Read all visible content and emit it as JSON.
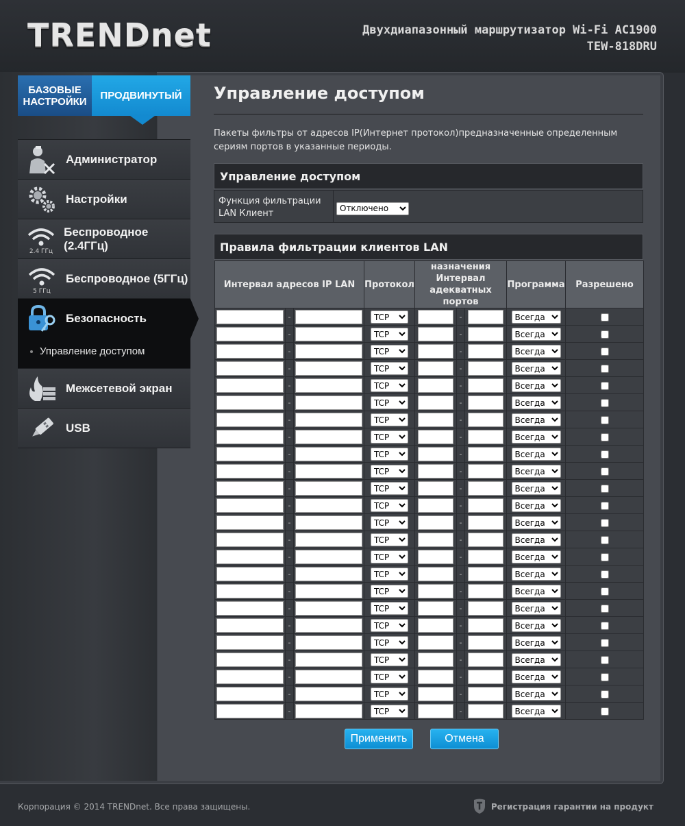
{
  "header": {
    "logo": "TRENDnet",
    "product_line1": "Двухдиапазонный маршрутизатор Wi-Fi AC1900",
    "product_line2": "TEW-818DRU"
  },
  "tabs": {
    "basic_line1": "БАЗОВЫЕ",
    "basic_line2": "НАСТРОЙКИ",
    "advanced": "ПРОДВИНУТЫЙ"
  },
  "sidebar": {
    "items": [
      {
        "label": "Администратор",
        "icon": "administrator-icon"
      },
      {
        "label": "Настройки",
        "icon": "gears-icon"
      },
      {
        "label": "Беспроводное (2.4ГГц)",
        "icon": "wifi-2-4ghz-icon",
        "icon_caption": "2.4 ГГц"
      },
      {
        "label": "Беспроводное (5ГГц)",
        "icon": "wifi-5ghz-icon",
        "icon_caption": "5 ГГц"
      },
      {
        "label": "Безопасность",
        "icon": "lock-key-icon"
      },
      {
        "label": "Межсетевой экран",
        "icon": "firewall-icon"
      },
      {
        "label": "USB",
        "icon": "usb-icon"
      }
    ],
    "sub_item": "Управление доступом"
  },
  "main": {
    "title": "Управление доступом",
    "description": "Пакеты фильтры от адресов IP(Интернет протокол)предназначенные определенным сериям портов в указанные периоды.",
    "access_section": {
      "title": "Управление доступом",
      "filter_label": "Функция фильтрации LAN Клиент",
      "filter_value": "Отключено"
    },
    "rules_section": {
      "title": "Правила фильтрации клиентов LAN",
      "columns": {
        "ip_range": "Интервал адресов IP LAN",
        "protocol": "Протокол",
        "port_range": "назначения Интервал адекватных портов",
        "schedule": "Программа",
        "allowed": "Разрешено"
      },
      "separator": "-",
      "rows": [
        {
          "ip_start": "",
          "ip_end": "",
          "protocol": "TCP",
          "port_start": "",
          "port_end": "",
          "schedule": "Всегда",
          "allowed": false
        },
        {
          "ip_start": "",
          "ip_end": "",
          "protocol": "TCP",
          "port_start": "",
          "port_end": "",
          "schedule": "Всегда",
          "allowed": false
        },
        {
          "ip_start": "",
          "ip_end": "",
          "protocol": "TCP",
          "port_start": "",
          "port_end": "",
          "schedule": "Всегда",
          "allowed": false
        },
        {
          "ip_start": "",
          "ip_end": "",
          "protocol": "TCP",
          "port_start": "",
          "port_end": "",
          "schedule": "Всегда",
          "allowed": false
        },
        {
          "ip_start": "",
          "ip_end": "",
          "protocol": "TCP",
          "port_start": "",
          "port_end": "",
          "schedule": "Всегда",
          "allowed": false
        },
        {
          "ip_start": "",
          "ip_end": "",
          "protocol": "TCP",
          "port_start": "",
          "port_end": "",
          "schedule": "Всегда",
          "allowed": false
        },
        {
          "ip_start": "",
          "ip_end": "",
          "protocol": "TCP",
          "port_start": "",
          "port_end": "",
          "schedule": "Всегда",
          "allowed": false
        },
        {
          "ip_start": "",
          "ip_end": "",
          "protocol": "TCP",
          "port_start": "",
          "port_end": "",
          "schedule": "Всегда",
          "allowed": false
        },
        {
          "ip_start": "",
          "ip_end": "",
          "protocol": "TCP",
          "port_start": "",
          "port_end": "",
          "schedule": "Всегда",
          "allowed": false
        },
        {
          "ip_start": "",
          "ip_end": "",
          "protocol": "TCP",
          "port_start": "",
          "port_end": "",
          "schedule": "Всегда",
          "allowed": false
        },
        {
          "ip_start": "",
          "ip_end": "",
          "protocol": "TCP",
          "port_start": "",
          "port_end": "",
          "schedule": "Всегда",
          "allowed": false
        },
        {
          "ip_start": "",
          "ip_end": "",
          "protocol": "TCP",
          "port_start": "",
          "port_end": "",
          "schedule": "Всегда",
          "allowed": false
        },
        {
          "ip_start": "",
          "ip_end": "",
          "protocol": "TCP",
          "port_start": "",
          "port_end": "",
          "schedule": "Всегда",
          "allowed": false
        },
        {
          "ip_start": "",
          "ip_end": "",
          "protocol": "TCP",
          "port_start": "",
          "port_end": "",
          "schedule": "Всегда",
          "allowed": false
        },
        {
          "ip_start": "",
          "ip_end": "",
          "protocol": "TCP",
          "port_start": "",
          "port_end": "",
          "schedule": "Всегда",
          "allowed": false
        },
        {
          "ip_start": "",
          "ip_end": "",
          "protocol": "TCP",
          "port_start": "",
          "port_end": "",
          "schedule": "Всегда",
          "allowed": false
        },
        {
          "ip_start": "",
          "ip_end": "",
          "protocol": "TCP",
          "port_start": "",
          "port_end": "",
          "schedule": "Всегда",
          "allowed": false
        },
        {
          "ip_start": "",
          "ip_end": "",
          "protocol": "TCP",
          "port_start": "",
          "port_end": "",
          "schedule": "Всегда",
          "allowed": false
        },
        {
          "ip_start": "",
          "ip_end": "",
          "protocol": "TCP",
          "port_start": "",
          "port_end": "",
          "schedule": "Всегда",
          "allowed": false
        },
        {
          "ip_start": "",
          "ip_end": "",
          "protocol": "TCP",
          "port_start": "",
          "port_end": "",
          "schedule": "Всегда",
          "allowed": false
        },
        {
          "ip_start": "",
          "ip_end": "",
          "protocol": "TCP",
          "port_start": "",
          "port_end": "",
          "schedule": "Всегда",
          "allowed": false
        },
        {
          "ip_start": "",
          "ip_end": "",
          "protocol": "TCP",
          "port_start": "",
          "port_end": "",
          "schedule": "Всегда",
          "allowed": false
        },
        {
          "ip_start": "",
          "ip_end": "",
          "protocol": "TCP",
          "port_start": "",
          "port_end": "",
          "schedule": "Всегда",
          "allowed": false
        },
        {
          "ip_start": "",
          "ip_end": "",
          "protocol": "TCP",
          "port_start": "",
          "port_end": "",
          "schedule": "Всегда",
          "allowed": false
        }
      ]
    },
    "buttons": {
      "apply": "Применить",
      "cancel": "Отмена"
    }
  },
  "footer": {
    "copyright": "Корпорация © 2014 TRENDnet. Все права защищены.",
    "warranty": "Регистрация гарантии на продукт",
    "warranty_icon": "shield-icon"
  },
  "colors": {
    "accent": "#138ad0",
    "accent_light": "#22a8e6",
    "basic_tab": "#1a4d86",
    "background": "#2b2e33",
    "content_bg": "#474a50",
    "section_head": "#26282c",
    "table_header": "#5c6066"
  }
}
